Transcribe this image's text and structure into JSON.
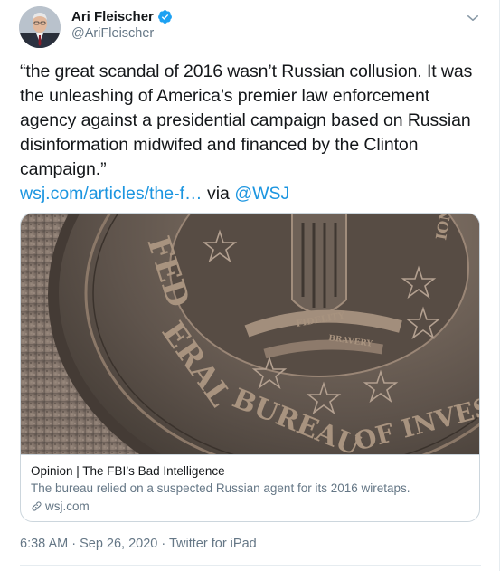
{
  "author": {
    "name": "Ari Fleischer",
    "handle": "@AriFleischer",
    "verified": true
  },
  "icons": {
    "verified": "verified-badge-icon",
    "menu": "chevron-down-icon",
    "link": "link-icon"
  },
  "colors": {
    "link": "#1b95e0",
    "verified": "#1da1f2",
    "secondary_text": "#657786"
  },
  "tweet": {
    "text": "“the great scandal of 2016 wasn’t Russian collusion. It was the unleashing of America’s premier law enforcement agency against a presidential campaign based on Russian disinformation midwifed and financed by the Clinton campaign.”",
    "link_text": "wsj.com/articles/the-f…",
    "via_text": " via ",
    "mention": "@WSJ"
  },
  "card": {
    "image_alt": "FBI seal: Federal Bureau of Investigation, Fidelity Bravery Integrity",
    "title": "Opinion | The FBI’s Bad Intelligence",
    "description": "The bureau relied on a suspected Russian agent for its 2016 wiretaps.",
    "domain": "wsj.com"
  },
  "meta": {
    "time": "6:38 AM",
    "separator": " · ",
    "date": "Sep 26, 2020",
    "source": "Twitter for iPad"
  }
}
